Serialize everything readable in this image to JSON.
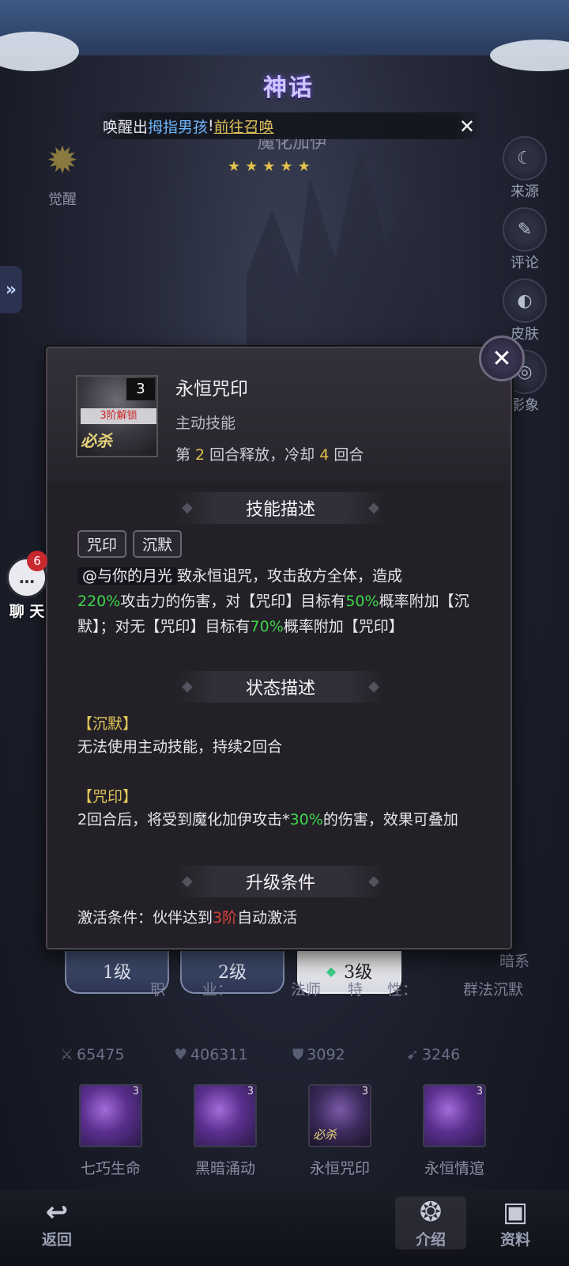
{
  "header": {
    "myth_badge": "神话",
    "hero_name": "魔化加伊",
    "stars": [
      "★",
      "★",
      "★",
      "★",
      "★"
    ],
    "awaken_label": "觉醒"
  },
  "notice": {
    "prefix": "唤醒出",
    "hero": "拇指男孩",
    "mark": "!",
    "link": "前往召唤",
    "close": "✕"
  },
  "side_buttons": [
    {
      "label": "来源",
      "icon": "☾"
    },
    {
      "label": "评论",
      "icon": "✎"
    },
    {
      "label": "皮肤",
      "icon": "◐"
    },
    {
      "label": "影象",
      "icon": "◎"
    }
  ],
  "chat": {
    "count": "6",
    "label": "聊 天"
  },
  "popup": {
    "skill_title": "永恒咒印",
    "skill_type": "主动技能",
    "skill_icon": {
      "level": "3",
      "unlock": "3阶解锁",
      "ult": "必杀"
    },
    "cd_text": {
      "a": "第 ",
      "round": "2",
      "b": " 回合释放，冷却 ",
      "cooldown": "4",
      "c": " 回合"
    },
    "close_icon": "✕",
    "sections": {
      "desc_title": "技能描述",
      "status_title": "状态描述",
      "upgrade_title": "升级条件"
    },
    "tags": [
      "咒印",
      "沉默"
    ],
    "description": {
      "mention": "@与你的月光",
      "l1": "致永恒诅咒，攻击敌方全体，造成",
      "g1": "220%",
      "l2": "攻击力的伤害，对【咒印】目标有",
      "g2": "50%",
      "l3": "概率附加【沉默】；对无【咒印】目标有",
      "g3": "70%",
      "l4": "概率附加【咒印】"
    },
    "statuses": [
      {
        "name": "【沉默】",
        "text": "无法使用主动技能，持续2回合"
      },
      {
        "name": "【咒印】",
        "text_a": "2回合后，将受到魔化加伊攻击*",
        "text_g": "30%",
        "text_b": "的伤害，效果可叠加"
      }
    ],
    "upgrade": {
      "a": "激活条件：伙伴达到",
      "r": "3阶",
      "b": "自动激活"
    }
  },
  "level_tabs": [
    {
      "label": "1级",
      "active": false
    },
    {
      "label": "2级",
      "active": false
    },
    {
      "label": "3级",
      "active": true
    }
  ],
  "info": {
    "job_label": "职",
    "pos_label": "业：",
    "job_value": "法师",
    "trait_label": "特",
    "trait_colon": "性：",
    "trait_value": "群法沉默",
    "element": "暗系"
  },
  "stats": [
    {
      "icon": "⚔",
      "value": "65475"
    },
    {
      "icon": "♥",
      "value": "406311"
    },
    {
      "icon": "⛊",
      "value": "3092"
    },
    {
      "icon": "➹",
      "value": "3246"
    }
  ],
  "skills": [
    {
      "name": "七巧生命",
      "level": "3",
      "ult": ""
    },
    {
      "name": "黑暗涌动",
      "level": "3",
      "ult": ""
    },
    {
      "name": "永恒咒印",
      "level": "3",
      "ult": "必杀"
    },
    {
      "name": "永恒情逭",
      "level": "3",
      "ult": ""
    }
  ],
  "nav": {
    "back": "返回",
    "intro": "介绍",
    "data": "资料"
  }
}
